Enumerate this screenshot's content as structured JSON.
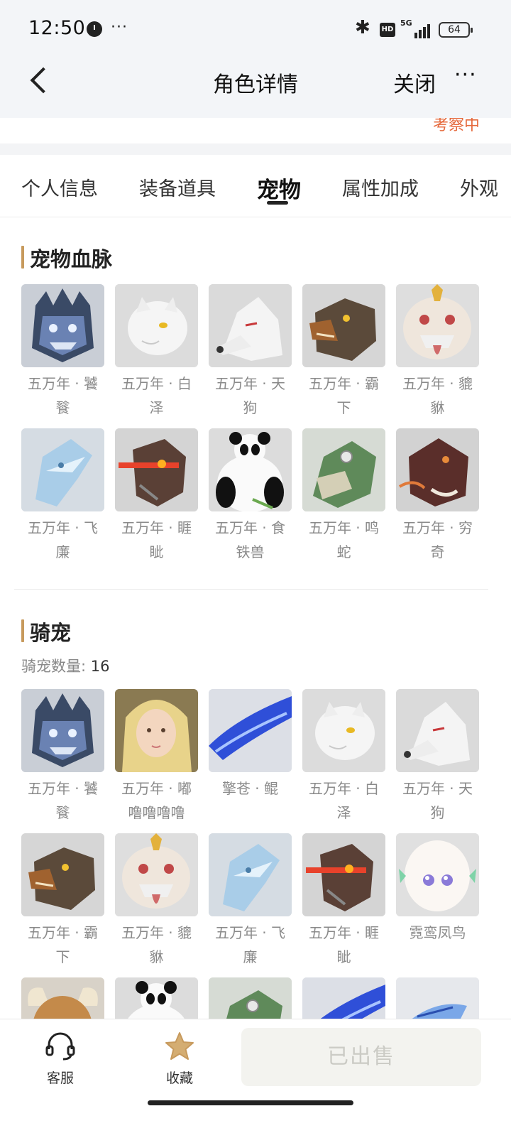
{
  "status_bar": {
    "time": "12:50",
    "more": "···",
    "network": "5G",
    "hd": "HD",
    "battery": "64"
  },
  "nav": {
    "title": "角色详情",
    "close_label": "关闭",
    "more_label": "···"
  },
  "prev_strip_text": "考察中",
  "tabs": [
    {
      "label": "个人信息",
      "active": false
    },
    {
      "label": "装备道具",
      "active": false
    },
    {
      "label": "宠物",
      "active": true
    },
    {
      "label": "属性加成",
      "active": false
    },
    {
      "label": "外观",
      "active": false
    }
  ],
  "pet_bloodline": {
    "title": "宠物血脉",
    "items": [
      {
        "name": "五万年 · 饕餮",
        "icon": "taotie-portrait-icon"
      },
      {
        "name": "五万年 · 白泽",
        "icon": "baize-portrait-icon"
      },
      {
        "name": "五万年 · 天狗",
        "icon": "tiangou-portrait-icon"
      },
      {
        "name": "五万年 · 霸下",
        "icon": "baxia-portrait-icon"
      },
      {
        "name": "五万年 · 貔貅",
        "icon": "pixiu-portrait-icon"
      },
      {
        "name": "五万年 · 飞廉",
        "icon": "feilian-portrait-icon"
      },
      {
        "name": "五万年 · 睚眦",
        "icon": "yazi-portrait-icon"
      },
      {
        "name": "五万年 · 食铁兽",
        "icon": "panda-portrait-icon"
      },
      {
        "name": "五万年 · 鸣蛇",
        "icon": "mingshe-portrait-icon"
      },
      {
        "name": "五万年 · 穷奇",
        "icon": "qiongqi-portrait-icon"
      }
    ]
  },
  "mounts": {
    "title": "骑宠",
    "count_label": "骑宠数量:",
    "count_value": "16",
    "items": [
      {
        "name": "五万年 · 饕餮",
        "icon": "taotie-portrait-icon"
      },
      {
        "name": "五万年 · 嘟噜噜噜噜",
        "icon": "girl-portrait-icon"
      },
      {
        "name": "擎苍 · 鲲",
        "icon": "kun-portrait-icon"
      },
      {
        "name": "五万年 · 白泽",
        "icon": "baize-portrait-icon"
      },
      {
        "name": "五万年 · 天狗",
        "icon": "tiangou-portrait-icon"
      },
      {
        "name": "五万年 · 霸下",
        "icon": "baxia-portrait-icon"
      },
      {
        "name": "五万年 · 貔貅",
        "icon": "pixiu-portrait-icon"
      },
      {
        "name": "五万年 · 飞廉",
        "icon": "feilian-portrait-icon"
      },
      {
        "name": "五万年 · 睚眦",
        "icon": "yazi-portrait-icon"
      },
      {
        "name": "霓鸾凤鸟",
        "icon": "fengniao-portrait-icon"
      },
      {
        "name": "",
        "icon": "bull-portrait-icon"
      },
      {
        "name": "",
        "icon": "panda-portrait-icon"
      },
      {
        "name": "",
        "icon": "mingshe-portrait-icon"
      },
      {
        "name": "",
        "icon": "kun-portrait-icon"
      },
      {
        "name": "",
        "icon": "fish-portrait-icon"
      }
    ]
  },
  "bottom_bar": {
    "service_label": "客服",
    "favorite_label": "收藏",
    "sold_label": "已出售"
  },
  "colors": {
    "accent_gold": "#c79a5d",
    "status_orange": "#e5693c"
  }
}
